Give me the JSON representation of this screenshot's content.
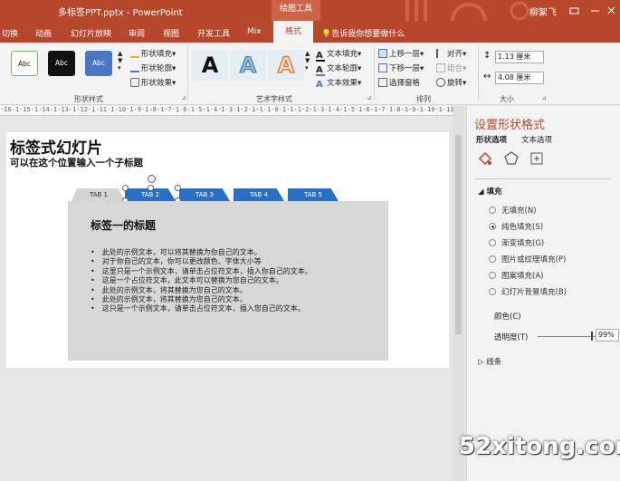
{
  "titlebar": {
    "doc_title": "多标签PPT.pptx  -  PowerPoint",
    "context_tab": "绘图工具",
    "user": "柳絮飞"
  },
  "ribbon_tabs": [
    "切换",
    "动画",
    "幻灯片放映",
    "审阅",
    "视图",
    "开发工具",
    "Mix",
    "格式"
  ],
  "tell_me": "告诉我你想要做什么",
  "shape_styles": {
    "swatches": [
      "Abc",
      "Abc",
      "Abc"
    ],
    "fill": "形状填充",
    "outline": "形状轮廓",
    "effects": "形状效果",
    "label": "形状样式"
  },
  "art_styles": {
    "letters": [
      "A",
      "A",
      "A"
    ],
    "text_fill": "文本填充",
    "text_outline": "文本轮廓",
    "text_effects": "文本效果",
    "label": "艺术字样式"
  },
  "arrange": {
    "bring_forward": "上移一层",
    "send_backward": "下移一层",
    "selection_pane": "选择窗格",
    "align": "对齐",
    "group": "组合",
    "rotate": "旋转",
    "label": "排列"
  },
  "size": {
    "height": "1.13 厘米",
    "width": "4.08 厘米",
    "label": "大小"
  },
  "ruler": "·16·1·15·1·14·1·13·1·12·1·11·1·10·1·9·1·8·1·7·1·6·1·5·1·4·1·3·1·2·1·1·1·0·1·1·1·2·1·3·1·4·1·5·1·6·1·7·1·8·1·9·1·10·1·11·1·12·1·13·1·14·1·15·1·16",
  "slide": {
    "title": "标签式幻灯片",
    "subtitle": "可以在这个位置输入一个子标题",
    "tabs": [
      "TAB 1",
      "TAB 2",
      "TAB 3",
      "TAB 4",
      "TAB 5"
    ],
    "content_title": "标签一的标题",
    "bullets": [
      "此处的示例文本，可以将其替换为你自己的文本。",
      "对于你自己的文本，你可以更改颜色、字体大小等",
      "这里只是一个示例文本，请单击占位符文本，插入你自己的文本。",
      "这是一个占位符文本，此文本可以替换为您自己的文本。",
      "此处的示例文本，将其替换为您自己的文本。",
      "此处的示例文本，将其替换为您自己的文本。",
      "这只是一个示例文本，请单击占位符文本，插入您自己的文本。"
    ]
  },
  "pane": {
    "title": "设置形状格式",
    "tab_shape": "形状选项",
    "tab_text": "文本选项",
    "fill_section": "填充",
    "fill_options": [
      "无填充(N)",
      "纯色填充(S)",
      "渐变填充(G)",
      "图片或纹理填充(P)",
      "图案填充(A)",
      "幻灯片背景填充(B)"
    ],
    "selected_fill": 1,
    "color_label": "颜色(C)",
    "transparency_label": "透明度(T)",
    "transparency_value": "99%",
    "line_section": "线条"
  },
  "watermark": "52xitong.com",
  "colors": {
    "accent": "#b7472a",
    "tab_blue": "#2a6fc0"
  }
}
